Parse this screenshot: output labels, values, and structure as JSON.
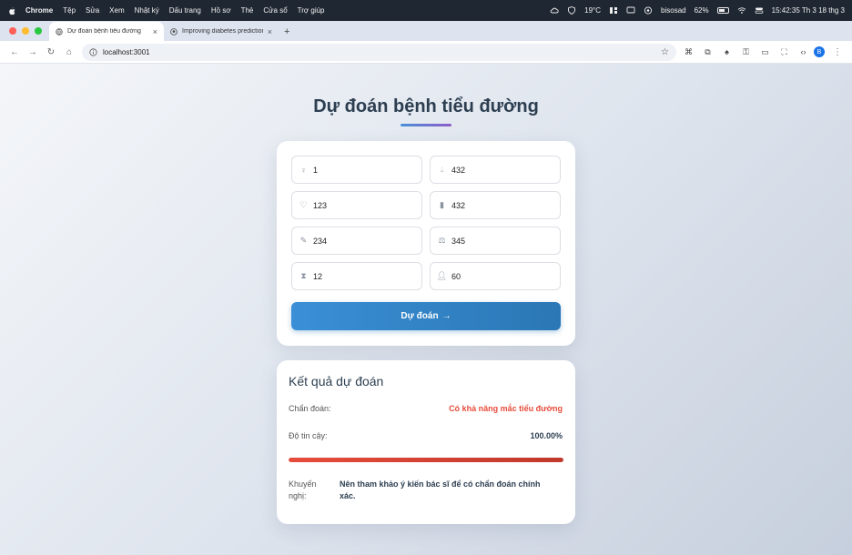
{
  "menubar": {
    "app": "Chrome",
    "items": [
      "Tệp",
      "Sửa",
      "Xem",
      "Nhật ký",
      "Dấu trang",
      "Hồ sơ",
      "Thẻ",
      "Cửa sổ",
      "Trợ giúp"
    ],
    "weather": "19°C",
    "user": "bisosad",
    "battery": "62%",
    "datetime": "15:42:35 Th 3 18 thg 3"
  },
  "tabs": [
    {
      "title": "Dự đoán bệnh tiểu đường",
      "active": true
    },
    {
      "title": "Improving diabetes prediction...",
      "active": false
    }
  ],
  "toolbar": {
    "url": "localhost:3001",
    "profile_initial": "B"
  },
  "page": {
    "title": "Dự đoán bệnh tiểu đường",
    "fields": [
      {
        "icon": "person-pregnant-icon",
        "value": "1"
      },
      {
        "icon": "droplet-icon",
        "value": "432"
      },
      {
        "icon": "heart-icon",
        "value": "123"
      },
      {
        "icon": "ruler-icon",
        "value": "432"
      },
      {
        "icon": "syringe-icon",
        "value": "234"
      },
      {
        "icon": "scale-icon",
        "value": "345"
      },
      {
        "icon": "hourglass-icon",
        "value": "12"
      },
      {
        "icon": "user-icon",
        "value": "60"
      }
    ],
    "predict_button": "Dự đoán"
  },
  "result": {
    "title": "Kết quả dự đoán",
    "diagnosis_label": "Chẩn đoán:",
    "diagnosis_value": "Có khả năng mắc tiểu đường",
    "confidence_label": "Độ tin cậy:",
    "confidence_value": "100.00%",
    "confidence_fraction": 1.0,
    "recommendation_label": "Khuyến nghị:",
    "recommendation_text": "Nên tham khảo ý kiến bác sĩ để có chẩn đoán chính xác."
  },
  "colors": {
    "accent": "#2b77b5",
    "danger": "#e74c3c",
    "title": "#2c3e50"
  }
}
